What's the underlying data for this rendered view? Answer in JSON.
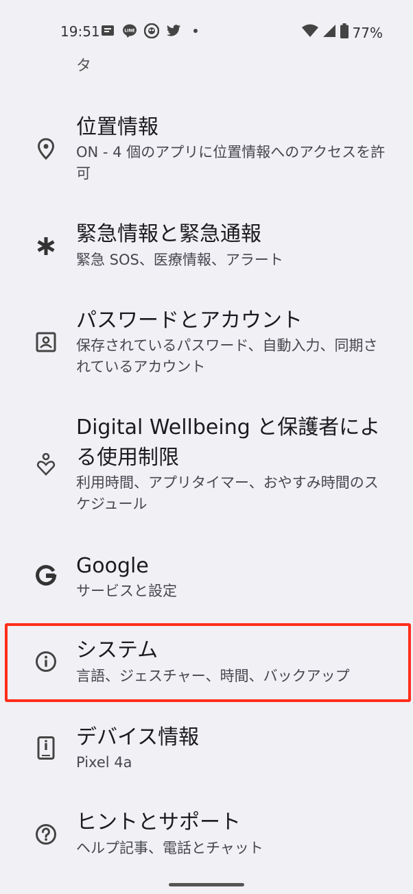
{
  "status_bar": {
    "time": "19:51",
    "notification_icons": [
      "message-icon",
      "line-icon",
      "webtoon-icon",
      "twitter-icon",
      "dot-icon"
    ],
    "battery_percent": "77%"
  },
  "partial_item": {
    "tail_text": "タ"
  },
  "settings_items": [
    {
      "id": "location",
      "icon": "location-pin-icon",
      "title": "位置情報",
      "subtitle": "ON - 4 個のアプリに位置情報へのアクセスを許可"
    },
    {
      "id": "safety",
      "icon": "asterisk-icon",
      "title": "緊急情報と緊急通報",
      "subtitle": "緊急 SOS、医療情報、アラート"
    },
    {
      "id": "passwords",
      "icon": "account-box-icon",
      "title": "パスワードとアカウント",
      "subtitle": "保存されているパスワード、自動入力、同期されているアカウント"
    },
    {
      "id": "wellbeing",
      "icon": "wellbeing-icon",
      "title": "Digital Wellbeing と保護者による使用制限",
      "subtitle": "利用時間、アプリタイマー、おやすみ時間のスケジュール"
    },
    {
      "id": "google",
      "icon": "google-g-icon",
      "title": "Google",
      "subtitle": "サービスと設定"
    },
    {
      "id": "system",
      "icon": "info-icon",
      "title": "システム",
      "subtitle": "言語、ジェスチャー、時間、バックアップ"
    },
    {
      "id": "device",
      "icon": "phone-icon",
      "title": "デバイス情報",
      "subtitle": "Pixel 4a"
    },
    {
      "id": "help",
      "icon": "help-icon",
      "title": "ヒントとサポート",
      "subtitle": "ヘルプ記事、電話とチャット"
    }
  ],
  "colors": {
    "background": "#f1f0f4",
    "highlight": "#ff2d1a",
    "text_primary": "#1b1b1f",
    "text_secondary": "#46464f"
  }
}
